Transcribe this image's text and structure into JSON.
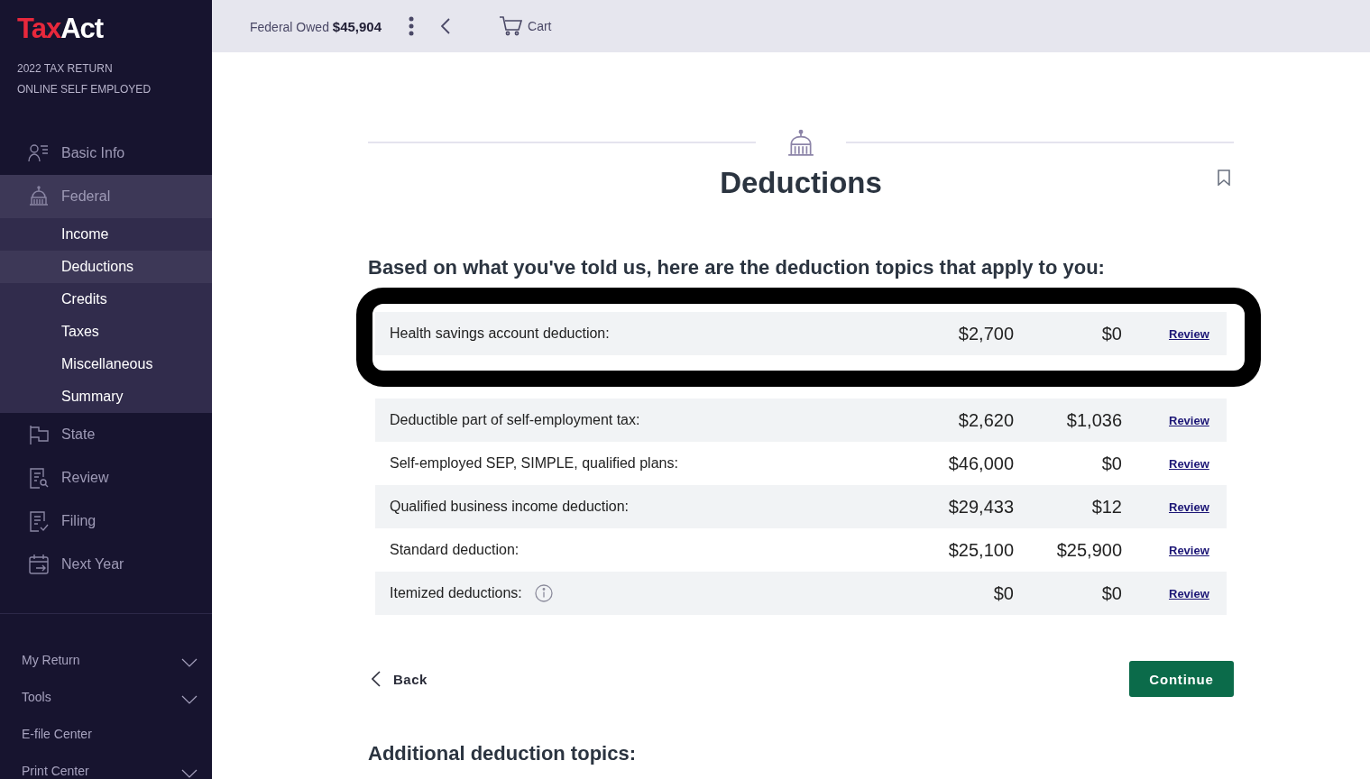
{
  "logo": {
    "part_1": "Tax",
    "part_2": "Act"
  },
  "return_info": [
    "2022 TAX RETURN",
    "ONLINE SELF EMPLOYED"
  ],
  "nav": [
    {
      "label": "Basic Info",
      "selected": false
    },
    {
      "label": "Federal",
      "selected": true,
      "children": [
        {
          "label": "Income",
          "selected": false
        },
        {
          "label": "Deductions",
          "selected": true
        },
        {
          "label": "Credits",
          "selected": false
        },
        {
          "label": "Taxes",
          "selected": false
        },
        {
          "label": "Miscellaneous",
          "selected": false
        },
        {
          "label": "Summary",
          "selected": false
        }
      ]
    },
    {
      "label": "State",
      "selected": false
    },
    {
      "label": "Review",
      "selected": false
    },
    {
      "label": "Filing",
      "selected": false
    },
    {
      "label": "Next Year",
      "selected": false
    }
  ],
  "bottom_menu": [
    {
      "label": "My Return",
      "has_menu": true
    },
    {
      "label": "Tools",
      "has_menu": true
    },
    {
      "label": "E-file Center",
      "has_menu": false
    },
    {
      "label": "Print Center",
      "has_menu": true
    }
  ],
  "top_bar": {
    "owed_label": "Federal Owed",
    "owed_amount": "$45,904",
    "cart": "Cart"
  },
  "page": {
    "title": "Deductions",
    "subtitle": "Based on what you've told us, here are the deduction topics that apply to you:",
    "rows": [
      {
        "kind": "row",
        "label": "Health savings account deduction:",
        "value_1": "$2,700",
        "value_2": "$0",
        "link": "Review",
        "info": false,
        "highlighted": true
      },
      {
        "kind": "hidden"
      },
      {
        "kind": "row",
        "label": "Deductible part of self-employment tax:",
        "value_1": "$2,620",
        "value_2": "$1,036",
        "link": "Review",
        "info": false,
        "highlighted": false
      },
      {
        "kind": "row",
        "label": "Self-employed SEP, SIMPLE, qualified plans:",
        "value_1": "$46,000",
        "value_2": "$0",
        "link": "Review",
        "info": false,
        "highlighted": false
      },
      {
        "kind": "row",
        "label": "Qualified business income deduction:",
        "value_1": "$29,433",
        "value_2": "$12",
        "link": "Review",
        "info": false,
        "highlighted": false
      },
      {
        "kind": "row",
        "label": "Standard deduction:",
        "value_1": "$25,100",
        "value_2": "$25,900",
        "link": "Review",
        "info": false,
        "highlighted": false
      },
      {
        "kind": "row",
        "label": "Itemized deductions:",
        "value_1": "$0",
        "value_2": "$0",
        "link": "Review",
        "info": true,
        "highlighted": false
      }
    ],
    "back": "Back",
    "continue": "Continue",
    "additional_heading": "Additional deduction topics:"
  }
}
